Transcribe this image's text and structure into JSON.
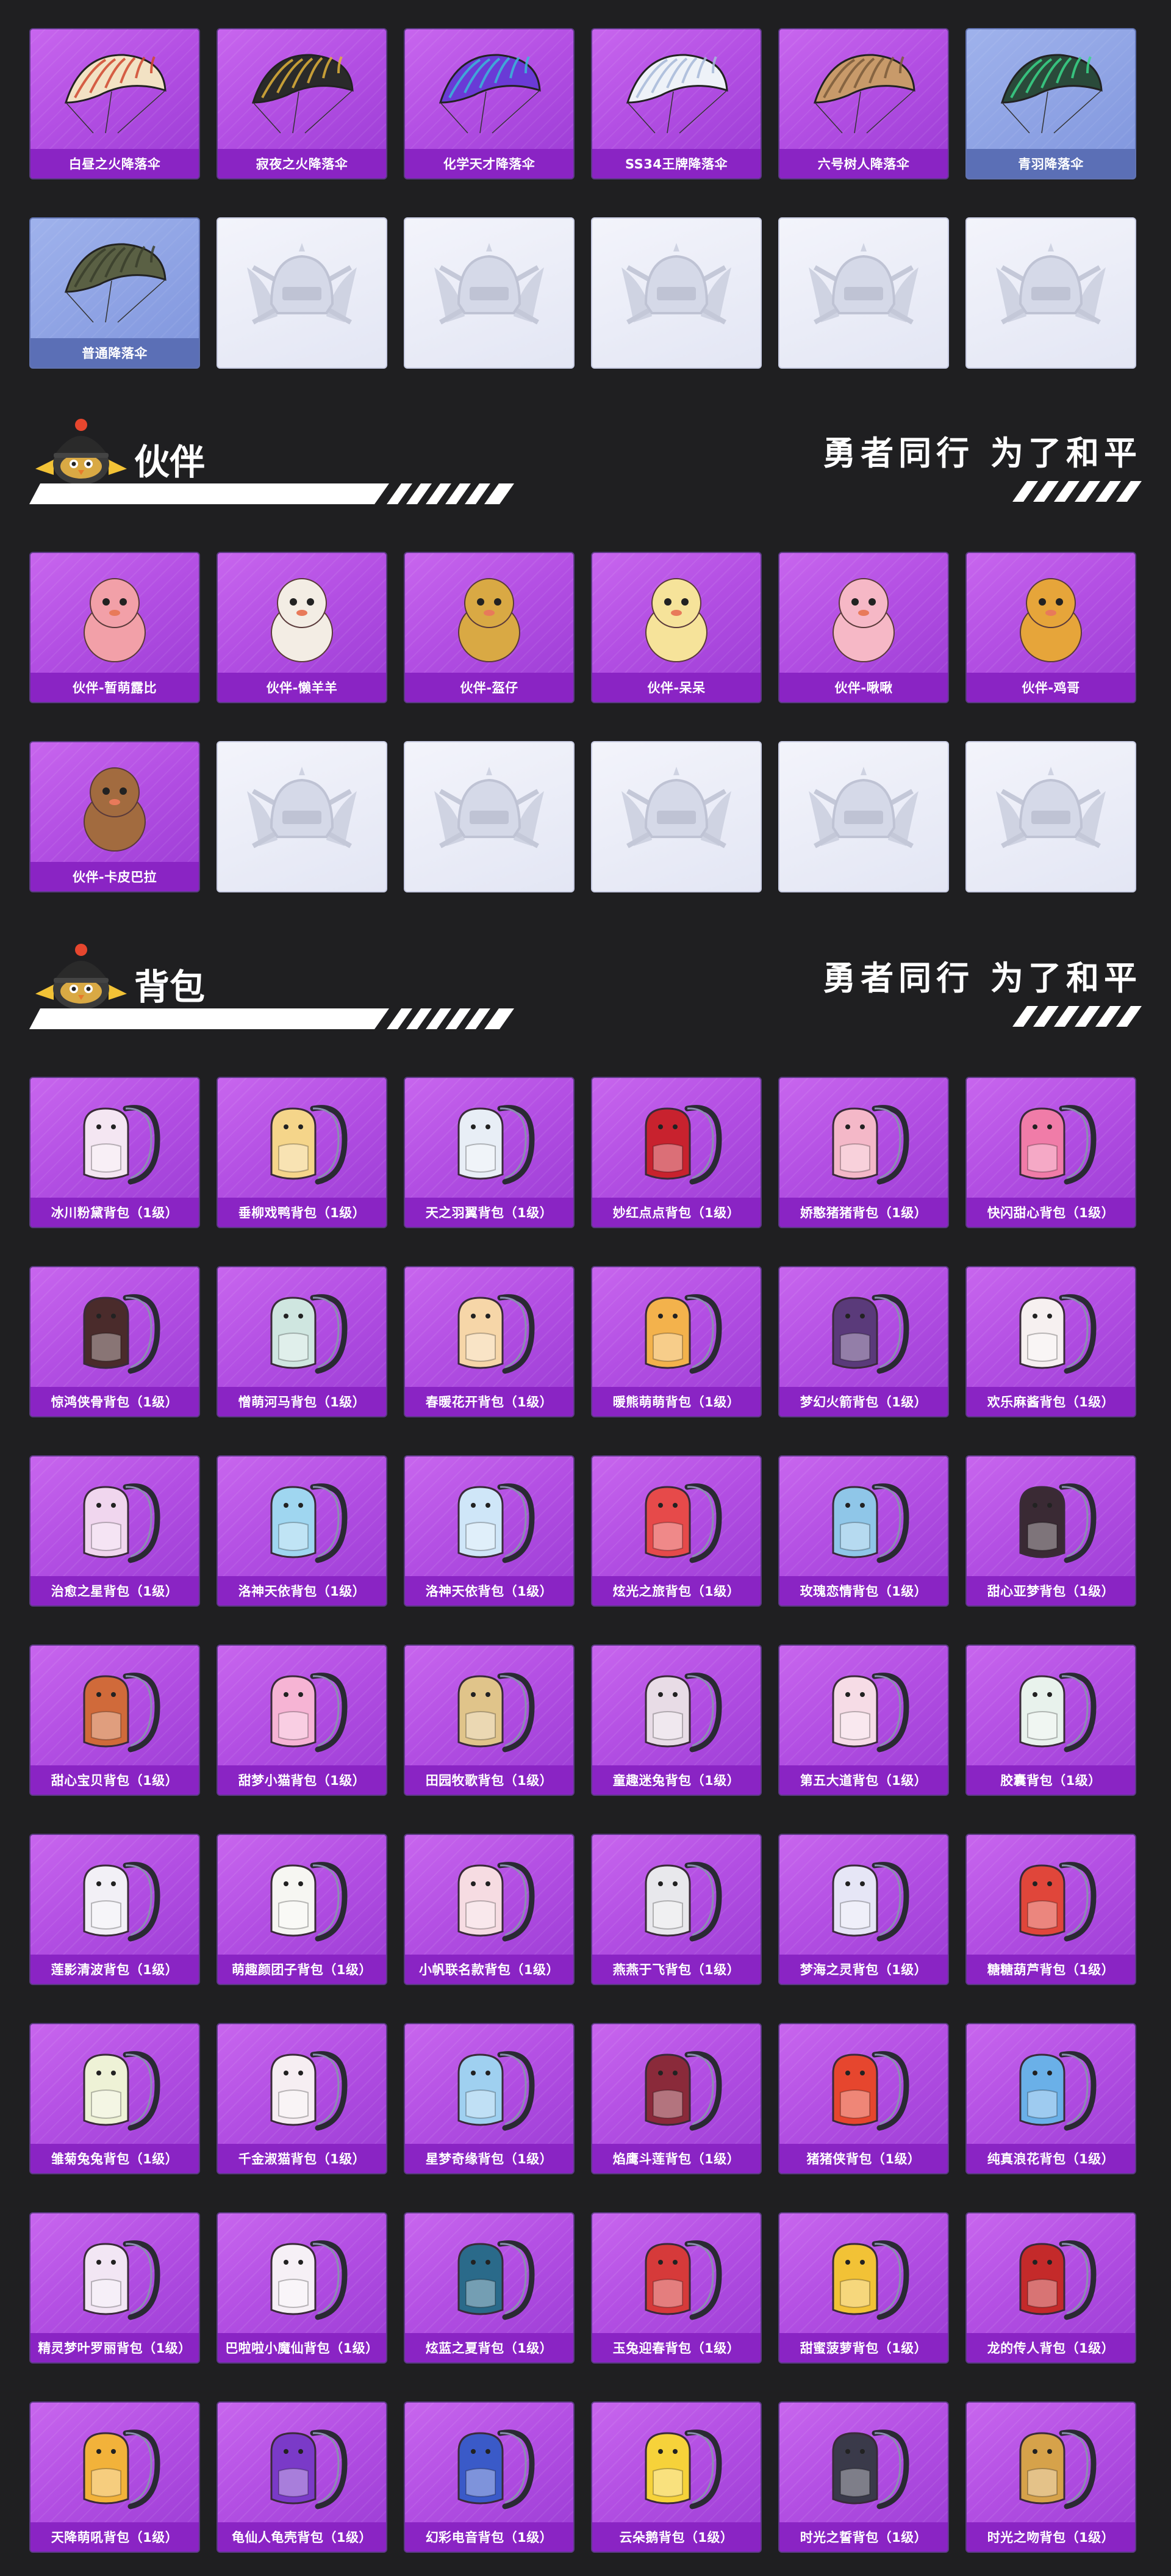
{
  "parachutes": {
    "items": [
      {
        "label": "白昼之火降落伞",
        "style": "red"
      },
      {
        "label": "寂夜之火降落伞",
        "style": "dark"
      },
      {
        "label": "化学天才降落伞",
        "style": "purple"
      },
      {
        "label": "SS34王牌降落伞",
        "style": "white"
      },
      {
        "label": "六号树人降落伞",
        "style": "tan"
      },
      {
        "label": "青羽降落伞",
        "style": "green"
      },
      {
        "label": "普通降落伞",
        "style": "olive"
      }
    ],
    "empty_slots": 5
  },
  "companions": {
    "title": "伙伴",
    "slogan": "勇者同行 为了和平",
    "items": [
      {
        "label": "伙伴-暂萌露比",
        "color": "#f2a0a8"
      },
      {
        "label": "伙伴-懒羊羊",
        "color": "#f3ede4"
      },
      {
        "label": "伙伴-盔仔",
        "color": "#d9a944"
      },
      {
        "label": "伙伴-呆呆",
        "color": "#f6e39a"
      },
      {
        "label": "伙伴-啾啾",
        "color": "#f6b8c6"
      },
      {
        "label": "伙伴-鸡哥",
        "color": "#e6a53a"
      },
      {
        "label": "伙伴-卡皮巴拉",
        "color": "#a26b3f"
      }
    ],
    "empty_slots": 5
  },
  "backpacks": {
    "title": "背包",
    "slogan": "勇者同行 为了和平",
    "items": [
      {
        "label": "冰川粉黛背包（1级）",
        "color": "#f4e6f2"
      },
      {
        "label": "垂柳戏鸭背包（1级）",
        "color": "#f5d58a"
      },
      {
        "label": "天之羽翼背包（1级）",
        "color": "#e8eef6"
      },
      {
        "label": "妙红点点背包（1级）",
        "color": "#c8222e"
      },
      {
        "label": "娇憨猪猪背包（1级）",
        "color": "#f4b8c8"
      },
      {
        "label": "快闪甜心背包（1级）",
        "color": "#f07ca8"
      },
      {
        "label": "惊鸿侠骨背包（1级）",
        "color": "#4a2b2b"
      },
      {
        "label": "憎萌河马背包（1级）",
        "color": "#cfe6e0"
      },
      {
        "label": "春暖花开背包（1级）",
        "color": "#f6d6a8"
      },
      {
        "label": "暖熊萌萌背包（1级）",
        "color": "#f3b24c"
      },
      {
        "label": "梦幻火箭背包（1级）",
        "color": "#5a3a7a"
      },
      {
        "label": "欢乐麻酱背包（1级）",
        "color": "#f6f0f0"
      },
      {
        "label": "治愈之星背包（1级）",
        "color": "#f0d6ee"
      },
      {
        "label": "洛神天依背包（1级）",
        "color": "#9fd6f0"
      },
      {
        "label": "洛神天依背包（1级）",
        "color": "#cfe6f8"
      },
      {
        "label": "炫光之旅背包（1级）",
        "color": "#e64a4a"
      },
      {
        "label": "玫瑰恋情背包（1级）",
        "color": "#8fc6e8"
      },
      {
        "label": "甜心亚梦背包（1级）",
        "color": "#3a2a34"
      },
      {
        "label": "甜心宝贝背包（1级）",
        "color": "#d06a3a"
      },
      {
        "label": "甜梦小猫背包（1级）",
        "color": "#f6b4d4"
      },
      {
        "label": "田园牧歌背包（1级）",
        "color": "#e0c48a"
      },
      {
        "label": "童趣迷兔背包（1级）",
        "color": "#e8dce6"
      },
      {
        "label": "第五大道背包（1级）",
        "color": "#f6dce6"
      },
      {
        "label": "胶囊背包（1级）",
        "color": "#e8f2ec"
      },
      {
        "label": "莲影清波背包（1级）",
        "color": "#f2f0f6"
      },
      {
        "label": "萌趣颜团子背包（1级）",
        "color": "#f6f6f2"
      },
      {
        "label": "小帆联名款背包（1级）",
        "color": "#f6dce2"
      },
      {
        "label": "燕燕于飞背包（1级）",
        "color": "#e8e8ec"
      },
      {
        "label": "梦海之灵背包（1级）",
        "color": "#e6e6f6"
      },
      {
        "label": "糖糖葫芦背包（1级）",
        "color": "#e0463a"
      },
      {
        "label": "雏菊兔兔背包（1级）",
        "color": "#eef2d6"
      },
      {
        "label": "千金淑猫背包（1级）",
        "color": "#f6eef2"
      },
      {
        "label": "星梦奇缘背包（1级）",
        "color": "#9fd0f0"
      },
      {
        "label": "焰鹰斗莲背包（1级）",
        "color": "#8a2a3a"
      },
      {
        "label": "猪猪侠背包（1级）",
        "color": "#e6462e"
      },
      {
        "label": "纯真浪花背包（1级）",
        "color": "#6ab0e8"
      },
      {
        "label": "精灵梦叶罗丽背包（1级）",
        "color": "#f2e6f4"
      },
      {
        "label": "巴啦啦小魔仙背包（1级）",
        "color": "#f6f0f6"
      },
      {
        "label": "炫蓝之夏背包（1级）",
        "color": "#2a6a8a"
      },
      {
        "label": "玉兔迎春背包（1级）",
        "color": "#d63a3a"
      },
      {
        "label": "甜蜜菠萝背包（1级）",
        "color": "#f2c236"
      },
      {
        "label": "龙的传人背包（1级）",
        "color": "#c42a2a"
      },
      {
        "label": "天降萌吼背包（1级）",
        "color": "#f2b23a"
      },
      {
        "label": "龟仙人龟壳背包（1级）",
        "color": "#7a3ac8"
      },
      {
        "label": "幻彩电音背包（1级）",
        "color": "#3a5ac8"
      },
      {
        "label": "云朵鹅背包（1级）",
        "color": "#f6d23a"
      },
      {
        "label": "时光之誓背包（1级）",
        "color": "#3a3a4a"
      },
      {
        "label": "时光之吻背包（1级）",
        "color": "#d6a24a"
      }
    ]
  }
}
